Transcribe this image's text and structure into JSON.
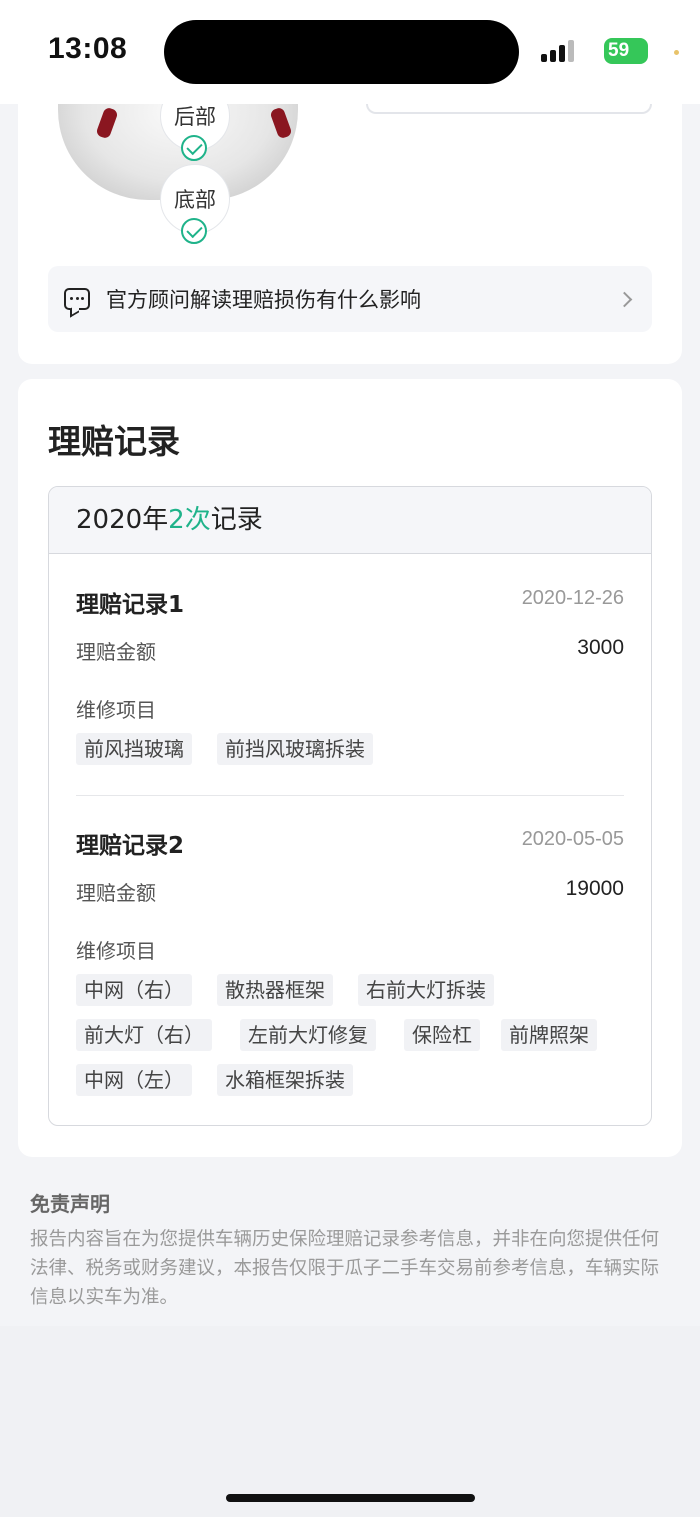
{
  "status_bar": {
    "time": "13:08",
    "battery": "59"
  },
  "damage_section": {
    "parts": [
      {
        "label": "后部",
        "status": "ok"
      },
      {
        "label": "底部",
        "status": "ok"
      }
    ],
    "advisor_link": "官方顾问解读理赔损伤有什么影响"
  },
  "claims": {
    "title": "理赔记录",
    "summary": {
      "prefix": "2020年",
      "count": "2次",
      "suffix": "记录"
    },
    "records": [
      {
        "title": "理赔记录1",
        "date": "2020-12-26",
        "amount_label": "理赔金额",
        "amount": "3000",
        "items_label": "维修项目",
        "items": [
          "前风挡玻璃",
          "前挡风玻璃拆装"
        ]
      },
      {
        "title": "理赔记录2",
        "date": "2020-05-05",
        "amount_label": "理赔金额",
        "amount": "19000",
        "items_label": "维修项目",
        "items": [
          "中网（右）",
          "散热器框架",
          "右前大灯拆装",
          "前大灯（右）",
          "左前大灯修复",
          "保险杠",
          "前牌照架",
          "中网（左）",
          "水箱框架拆装"
        ]
      }
    ]
  },
  "disclaimer": {
    "title": "免责声明",
    "text": "报告内容旨在为您提供车辆历史保险理赔记录参考信息，并非在向您提供任何法律、税务或财务建议，本报告仅限于瓜子二手车交易前参考信息，车辆实际信息以实车为准。"
  },
  "colors": {
    "accent": "#1fb38a",
    "background": "#f3f4f7"
  }
}
